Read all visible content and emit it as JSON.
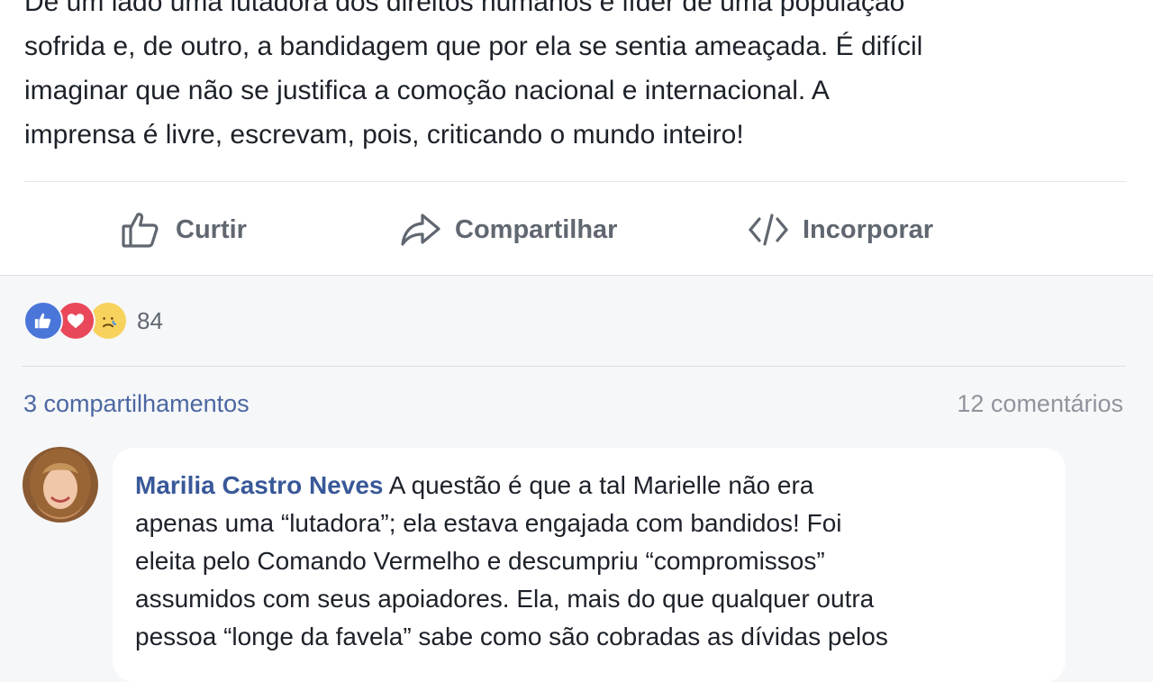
{
  "post": {
    "text_lines": [
      "De um lado uma lutadora dos direitos humanos e líder de uma população",
      "sofrida e, de outro, a bandidagem que por ela se sentia ameaçada. É difícil",
      "imaginar que não se justifica a comoção nacional e internacional. A",
      "imprensa é livre, escrevam, pois, criticando o mundo inteiro!"
    ]
  },
  "actions": {
    "like_label": "Curtir",
    "share_label": "Compartilhar",
    "embed_label": "Incorporar"
  },
  "reactions": {
    "icons": [
      "like-icon",
      "love-icon",
      "sad-icon"
    ],
    "count": "84"
  },
  "stats": {
    "shares": "3 compartilhamentos",
    "comments": "12 comentários"
  },
  "comment": {
    "author": "Marilia Castro Neves",
    "first_line_text": " A questão é que a tal Marielle não era",
    "lines": [
      "apenas uma “lutadora”; ela estava engajada com bandidos! Foi",
      "eleita pelo Comando Vermelho e descumpriu “compromissos”",
      "assumidos com seus apoiadores. Ela, mais do que qualquer outra",
      "pessoa “longe da favela” sabe como são cobradas as dívidas pelos"
    ]
  },
  "colors": {
    "link_blue": "#385898",
    "muted_gray": "#606770",
    "like_blue": "#4a76d9",
    "love_red": "#e9475a",
    "sad_yellow": "#f7d35e"
  }
}
